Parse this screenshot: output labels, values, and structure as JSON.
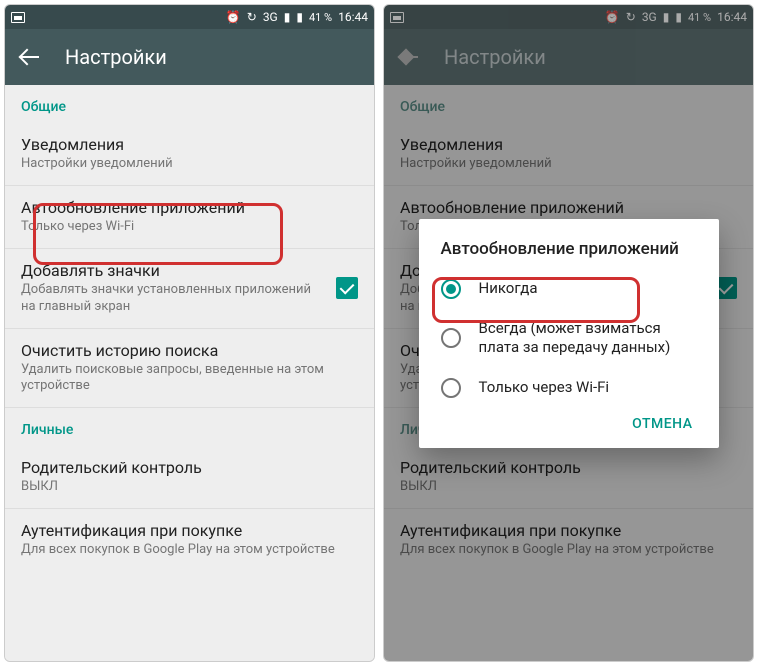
{
  "status": {
    "network": "3G",
    "battery_pct": "41 %",
    "time": "16:44"
  },
  "toolbar": {
    "title": "Настройки"
  },
  "sections": {
    "general": "Общие",
    "personal": "Личные"
  },
  "items": {
    "notifications": {
      "title": "Уведомления",
      "sub": "Настройки уведомлений"
    },
    "autoupdate": {
      "title": "Автообновление приложений",
      "sub": "Только через Wi-Fi"
    },
    "addicons": {
      "title": "Добавлять значки",
      "sub": "Добавлять значки установленных приложений на главный экран"
    },
    "clearhistory": {
      "title": "Очистить историю поиска",
      "sub": "Удалить поисковые запросы, введенные на этом устройстве"
    },
    "parental": {
      "title": "Родительский контроль",
      "sub": "ВЫКЛ"
    },
    "auth": {
      "title": "Аутентификация при покупке",
      "sub": "Для всех покупок в Google Play на этом устройстве"
    }
  },
  "dialog": {
    "title": "Автообновление приложений",
    "opt_never": "Никогда",
    "opt_always": "Всегда (может взиматься плата за передачу данных)",
    "opt_wifi": "Только через Wi-Fi",
    "cancel": "ОТМЕНА"
  }
}
